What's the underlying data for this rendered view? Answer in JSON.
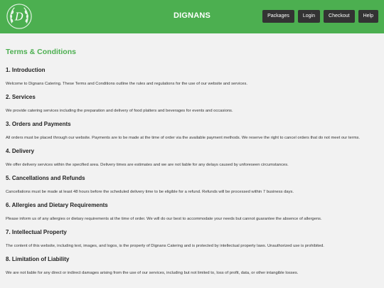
{
  "brand": "DIGNANS",
  "nav": [
    "Packages",
    "Login",
    "Checkout",
    "Help"
  ],
  "title": "Terms & Conditions",
  "sections": [
    {
      "heading": "1. Introduction",
      "body": "Welcome to Dignans Catering. These Terms and Conditions outline the rules and regulations for the use of our website and services."
    },
    {
      "heading": "2. Services",
      "body": "We provide catering services including the preparation and delivery of food platters and beverages for events and occasions."
    },
    {
      "heading": "3. Orders and Payments",
      "body": "All orders must be placed through our website. Payments are to be made at the time of order via the available payment methods. We reserve the right to cancel orders that do not meet our terms."
    },
    {
      "heading": "4. Delivery",
      "body": "We offer delivery services within the specified area. Delivery times are estimates and we are not liable for any delays caused by unforeseen circumstances."
    },
    {
      "heading": "5. Cancellations and Refunds",
      "body": "Cancellations must be made at least 48 hours before the scheduled delivery time to be eligible for a refund. Refunds will be processed within 7 business days."
    },
    {
      "heading": "6. Allergies and Dietary Requirements",
      "body": "Please inform us of any allergies or dietary requirements at the time of order. We will do our best to accommodate your needs but cannot guarantee the absence of allergens."
    },
    {
      "heading": "7. Intellectual Property",
      "body": "The content of this website, including text, images, and logos, is the property of Dignans Catering and is protected by intellectual property laws. Unauthorized use is prohibited."
    },
    {
      "heading": "8. Limitation of Liability",
      "body": "We are not liable for any direct or indirect damages arising from the use of our services, including but not limited to, loss of profit, data, or other intangible losses."
    }
  ],
  "colors": {
    "accent": "#4caf50",
    "nav_bg": "#333333"
  },
  "logo_letter": "D"
}
